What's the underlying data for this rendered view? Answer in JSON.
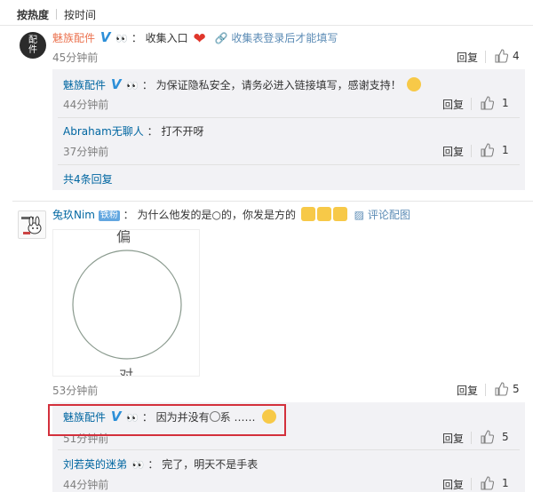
{
  "sort": {
    "hot_label": "按热度",
    "time_label": "按时间"
  },
  "comment1": {
    "avatar_text_line1": "配",
    "avatar_text_line2": "件",
    "author": "魅族配件",
    "text": "收集入口",
    "link_label": "收集表登录后才能填写",
    "time": "45分钟前",
    "reply_label": "回复",
    "likes": "4",
    "replies": [
      {
        "author": "魅族配件",
        "text": "为保证隐私安全，请务必进入链接填写，感谢支持！",
        "time": "44分钟前",
        "reply_label": "回复",
        "likes": "1"
      },
      {
        "author": "Abraham无聊人",
        "text": "打不开呀",
        "time": "37分钟前",
        "reply_label": "回复",
        "likes": "1"
      }
    ],
    "more_replies": "共4条回复"
  },
  "comment2": {
    "author": "兔玖Nim",
    "fan_badge": "铁粉",
    "text": "为什么他发的是○的，你发是方的",
    "link_label": "评论配图",
    "image_top_text": "偏",
    "image_bottom_text": "对",
    "time": "53分钟前",
    "reply_label": "回复",
    "likes": "5",
    "replies": [
      {
        "author": "魅族配件",
        "text": "因为并没有",
        "text_suffix": "系 ……",
        "time": "51分钟前",
        "reply_label": "回复",
        "likes": "5"
      },
      {
        "author": "刘若英的迷弟",
        "text": "完了，明天不是手表",
        "time": "44分钟前",
        "reply_label": "回复",
        "likes": "1"
      }
    ]
  },
  "colors": {
    "name_orange": "#eb7350",
    "name_blue": "#0066a1",
    "highlight_red": "#d3303c",
    "verified_blue": "#2c8fd8"
  }
}
